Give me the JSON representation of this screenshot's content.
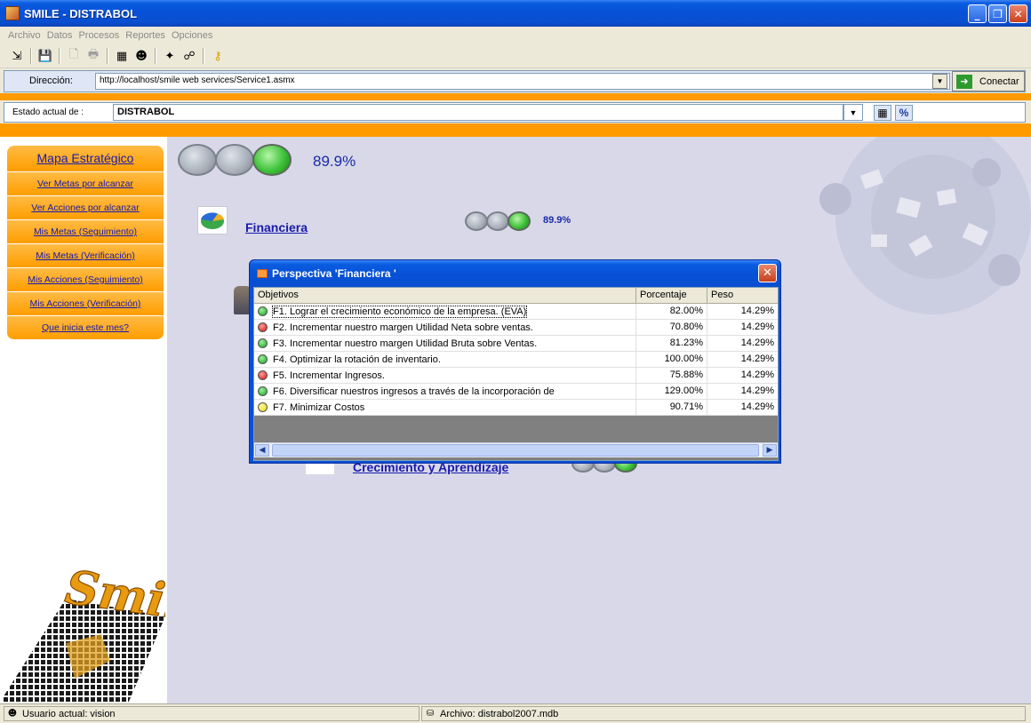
{
  "window": {
    "title": "SMILE - DISTRABOL"
  },
  "menu": [
    "Archivo",
    "Datos",
    "Procesos",
    "Reportes",
    "Opciones"
  ],
  "address": {
    "label": "Dirección:",
    "value": "http://localhost/smile web services/Service1.asmx",
    "connect_label": "Conectar"
  },
  "estado": {
    "label": "Estado actual de :",
    "value": "DISTRABOL",
    "pct_button": "%"
  },
  "sidebar": {
    "items": [
      "Mapa Estratégico",
      "Ver Metas por alcanzar",
      "Ver Acciones por alcanzar",
      "Mis Metas (Seguimiento)",
      "Mis Metas (Verificación)",
      "Mis Acciones (Seguimiento)",
      "Mis Acciones (Verificación)",
      "Que inicia este mes?"
    ],
    "logo_text": "Smile"
  },
  "overview": {
    "total_pct": "89.9%",
    "financiera_label": "Financiera",
    "financiera_pct": "89.9%",
    "crecimiento_label": "Crecimiento y Aprendizaje"
  },
  "dialog": {
    "title": "Perspectiva 'Financiera '",
    "columns": [
      "Objetivos",
      "Porcentaje",
      "Peso"
    ],
    "rows": [
      {
        "status": "green",
        "objetivo": "F1. Lograr el crecimiento económico de la empresa. (EVA)",
        "porcentaje": "82.00%",
        "peso": "14.29%"
      },
      {
        "status": "red",
        "objetivo": "F2. Incrementar nuestro margen Utilidad Neta sobre ventas.",
        "porcentaje": "70.80%",
        "peso": "14.29%"
      },
      {
        "status": "green",
        "objetivo": "F3. Incrementar nuestro margen Utilidad Bruta sobre Ventas.",
        "porcentaje": "81.23%",
        "peso": "14.29%"
      },
      {
        "status": "green",
        "objetivo": "F4. Optimizar la rotación de inventario.",
        "porcentaje": "100.00%",
        "peso": "14.29%"
      },
      {
        "status": "red",
        "objetivo": "F5. Incrementar Ingresos.",
        "porcentaje": "75.88%",
        "peso": "14.29%"
      },
      {
        "status": "green",
        "objetivo": "F6. Diversificar nuestros ingresos a través de la incorporación  de",
        "porcentaje": "129.00%",
        "peso": "14.29%"
      },
      {
        "status": "yellow",
        "objetivo": "F7. Minimizar Costos",
        "porcentaje": "90.71%",
        "peso": "14.29%"
      }
    ]
  },
  "status": {
    "user": "Usuario actual: vision",
    "file": "Archivo: distrabol2007.mdb"
  }
}
